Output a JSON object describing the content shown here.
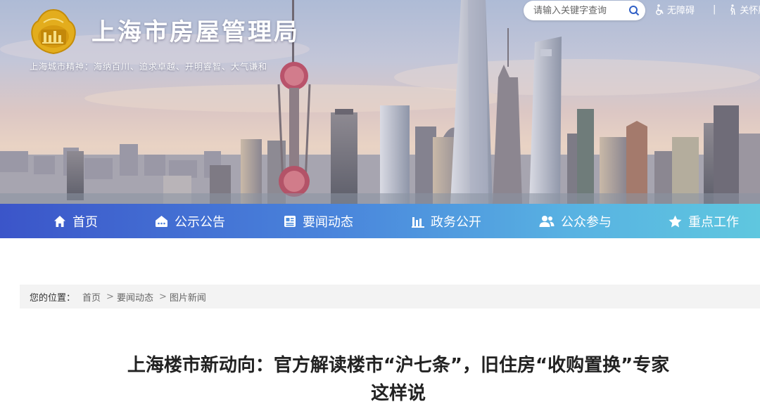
{
  "header": {
    "site_title": "上海市房屋管理局",
    "spirit_text": "上海城市精神：海纳百川、追求卓越、开明睿智、大气谦和",
    "search": {
      "placeholder": "请输入关键字查询"
    },
    "accessibility_label": "无障碍",
    "care_label": "关怀版"
  },
  "nav": {
    "items": [
      {
        "label": "首页",
        "icon": "home-icon"
      },
      {
        "label": "公示公告",
        "icon": "announcement-icon"
      },
      {
        "label": "要闻动态",
        "icon": "news-icon"
      },
      {
        "label": "政务公开",
        "icon": "bar-chart-icon"
      },
      {
        "label": "公众参与",
        "icon": "people-icon"
      },
      {
        "label": "重点工作",
        "icon": "star-icon"
      }
    ]
  },
  "breadcrumb": {
    "label": "您的位置：",
    "items": [
      "首页",
      "要闻动态",
      "图片新闻"
    ],
    "separator": ">"
  },
  "article": {
    "title_line1": "上海楼市新动向：官方解读楼市“沪七条”，旧住房“收购置换”专家",
    "title_line2": "这样说"
  },
  "colors": {
    "nav_gradient_start": "#3b55c9",
    "nav_gradient_end": "#5fc7df",
    "logo_gold": "#e3ad1d",
    "breadcrumb_bg": "#f3f3f3"
  }
}
